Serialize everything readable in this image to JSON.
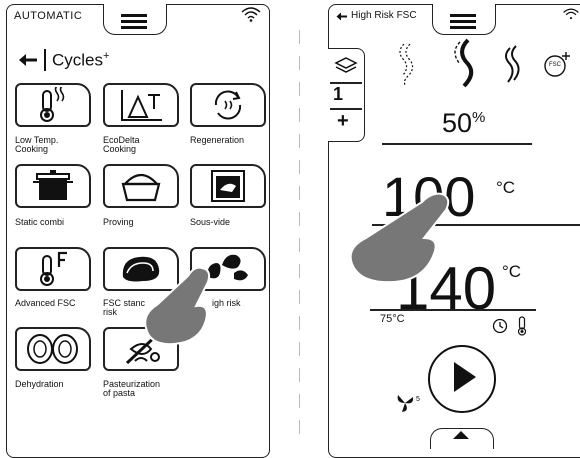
{
  "left_screen": {
    "mode_label": "AUTOMATIC",
    "header_title": "Cycles",
    "header_superscript": "+",
    "tiles": [
      {
        "label": "Low Temp.\nCooking",
        "icon": "thermometer-wave-icon"
      },
      {
        "label": "EcoDelta\nCooking",
        "icon": "delta-t-icon"
      },
      {
        "label": "Regeneration",
        "icon": "regeneration-icon"
      },
      {
        "label": "Static combi",
        "icon": "pot-icon"
      },
      {
        "label": "Proving",
        "icon": "bread-dough-icon"
      },
      {
        "label": "Sous-vide",
        "icon": "sous-vide-bag-icon"
      },
      {
        "label": "Advanced FSC",
        "icon": "thermometer-f-icon"
      },
      {
        "label": "FSC standard risk",
        "icon": "meat-icon"
      },
      {
        "label": "FSC high risk",
        "icon": "chicken-icon"
      },
      {
        "label": "Dehydration",
        "icon": "dehydration-icon"
      },
      {
        "label": "Pasteurization\nof pasta",
        "icon": "pasta-icon"
      }
    ],
    "visible_labels": {
      "t1a": "Low Temp.",
      "t1b": "Cooking",
      "t2a": "EcoDelta",
      "t2b": "Cooking",
      "t3": "Regeneration",
      "t4": "Static combi",
      "t5": "Proving",
      "t6": "Sous-vide",
      "t7": "Advanced FSC",
      "t8a": "FSC stanc",
      "t8b": "risk",
      "t9": "igh risk",
      "t10": "Dehydration",
      "t11a": "Pasteurization",
      "t11b": "of pasta"
    }
  },
  "right_screen": {
    "mode_label": "High Risk FSC",
    "side_tab_number": "1",
    "side_tab_plus": "+",
    "humidity_value": "50",
    "humidity_unit": "%",
    "chamber_temp": "100",
    "chamber_unit": "°C",
    "core_temp": "140",
    "core_unit": "°C",
    "core_probe_label": "75°C",
    "fan_speed": "5",
    "fsc_badge": "FSC"
  }
}
